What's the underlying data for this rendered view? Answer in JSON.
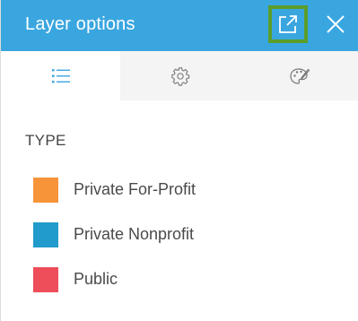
{
  "header": {
    "title": "Layer options",
    "popout_icon": "popout-icon",
    "close_icon": "close-icon",
    "background_color": "#3aa6e0",
    "highlight_color": "#5b9e2a"
  },
  "tabs": [
    {
      "name": "legend",
      "icon": "list-icon",
      "active": true
    },
    {
      "name": "options",
      "icon": "gear-icon",
      "active": false
    },
    {
      "name": "appearance",
      "icon": "palette-icon",
      "active": false
    }
  ],
  "legend": {
    "section_label": "TYPE",
    "items": [
      {
        "label": "Private For-Profit",
        "color": "#f7943a"
      },
      {
        "label": "Private Nonprofit",
        "color": "#219bcb"
      },
      {
        "label": "Public",
        "color": "#ee4d5a"
      }
    ]
  }
}
